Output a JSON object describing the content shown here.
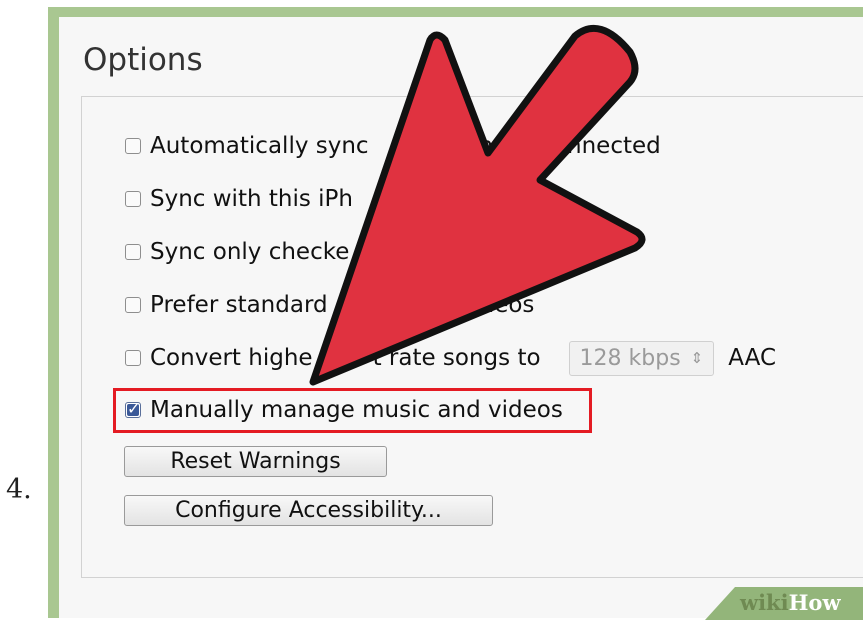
{
  "step_number": "4.",
  "panel": {
    "title": "Options",
    "options": [
      {
        "label": "Automatically sync",
        "label_tail": "ne is connected",
        "checked": false
      },
      {
        "label": "Sync with this iPh",
        "checked": false
      },
      {
        "label": "Sync only checke",
        "checked": false
      },
      {
        "label": "Prefer standard",
        "label_tail": "deos",
        "checked": false
      },
      {
        "label": "Convert highe",
        "label_tail": "t rate songs to",
        "checked": false,
        "select_value": "128 kbps",
        "select_suffix": "AAC"
      },
      {
        "label": "Manually manage music and videos",
        "checked": true
      }
    ],
    "buttons": {
      "reset": "Reset Warnings",
      "accessibility": "Configure Accessibility..."
    }
  },
  "annotation": {
    "arrow_color": "#e03240",
    "highlight_color": "#e41b23"
  },
  "watermark": {
    "part1": "wiki",
    "part2": "How"
  }
}
